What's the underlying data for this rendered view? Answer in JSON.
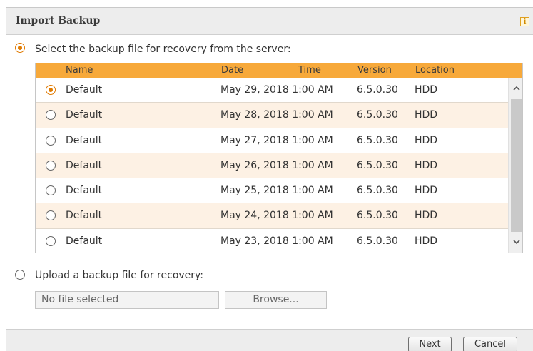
{
  "dialog": {
    "title": "Import Backup",
    "info_icon": "i"
  },
  "option_server": {
    "label": "Select the backup file for recovery from the server:",
    "selected": true
  },
  "table": {
    "columns": [
      "Name",
      "Date",
      "Time",
      "Version",
      "Location"
    ],
    "rows": [
      {
        "name": "Default",
        "datetime": "May 29, 2018 1:00 AM",
        "version": "6.5.0.30",
        "location": "HDD",
        "selected": true
      },
      {
        "name": "Default",
        "datetime": "May 28, 2018 1:00 AM",
        "version": "6.5.0.30",
        "location": "HDD",
        "selected": false
      },
      {
        "name": "Default",
        "datetime": "May 27, 2018 1:00 AM",
        "version": "6.5.0.30",
        "location": "HDD",
        "selected": false
      },
      {
        "name": "Default",
        "datetime": "May 26, 2018 1:00 AM",
        "version": "6.5.0.30",
        "location": "HDD",
        "selected": false
      },
      {
        "name": "Default",
        "datetime": "May 25, 2018 1:00 AM",
        "version": "6.5.0.30",
        "location": "HDD",
        "selected": false
      },
      {
        "name": "Default",
        "datetime": "May 24, 2018 1:00 AM",
        "version": "6.5.0.30",
        "location": "HDD",
        "selected": false
      },
      {
        "name": "Default",
        "datetime": "May 23, 2018 1:00 AM",
        "version": "6.5.0.30",
        "location": "HDD",
        "selected": false
      }
    ],
    "scroll_up_icon": "chevron-up-icon",
    "scroll_down_icon": "chevron-down-icon"
  },
  "option_upload": {
    "label": "Upload a backup file for recovery:",
    "selected": false,
    "file_value": "No file selected",
    "browse_label": "Browse..."
  },
  "footer": {
    "next_label": "Next",
    "cancel_label": "Cancel"
  },
  "colors": {
    "header_orange": "#f7a93a",
    "alt_row": "#fdf1e4",
    "radio_accent": "#e07a00"
  }
}
